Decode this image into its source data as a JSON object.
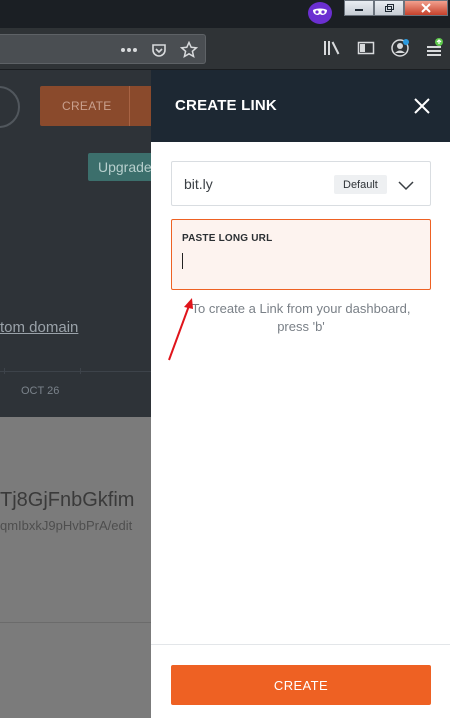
{
  "colors": {
    "accent": "#ee6123",
    "panel_header": "#1d2833",
    "annotation": "#e0141b",
    "url_field_bg": "#fdf3ef"
  },
  "browser": {
    "window_controls": [
      "minimize-icon",
      "maximize-icon",
      "close-icon"
    ],
    "extension_icon": "mask-icon",
    "url_actions": [
      "more-icon",
      "pocket-icon",
      "bookmark-star-icon"
    ],
    "toolbar_icons": [
      "library-icon",
      "sidebar-icon",
      "account-icon",
      "menu-icon"
    ]
  },
  "background_page": {
    "create_label": "CREATE",
    "upgrade_label": "Upgrade",
    "custom_domain_link": "tom domain",
    "chart_date": "OCT 26",
    "link_title": "Tj8GjFnbGkfim",
    "link_url": "qmIbxkJ9pHvbPrA/edit"
  },
  "panel": {
    "title": "CREATE LINK",
    "domain": {
      "value": "bit.ly",
      "badge": "Default"
    },
    "long_url": {
      "label": "PASTE LONG URL",
      "value": "",
      "placeholder": ""
    },
    "hint": "To create a Link from your dashboard, press 'b'",
    "create_label": "CREATE"
  }
}
